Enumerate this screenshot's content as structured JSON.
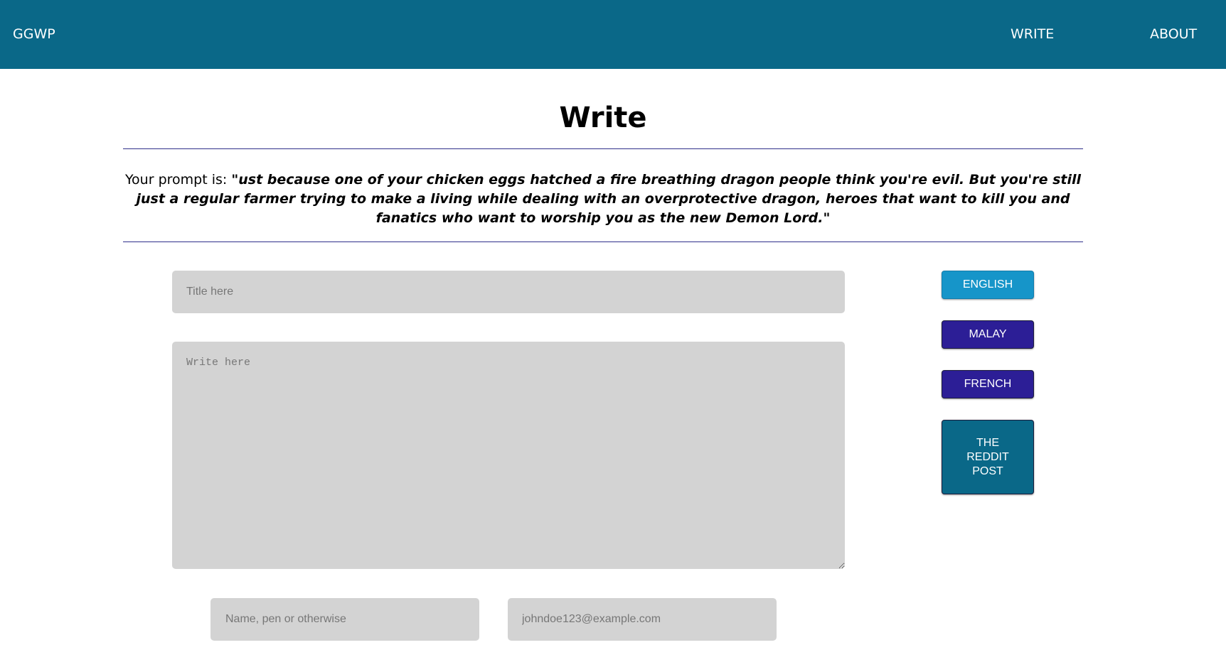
{
  "nav": {
    "brand": "GGWP",
    "links": [
      "WRITE",
      "ABOUT"
    ]
  },
  "page": {
    "title": "Write"
  },
  "prompt": {
    "label": "Your prompt is: ",
    "text": "\"ust because one of your chicken eggs hatched a fire breathing dragon people think you're evil. But you're still just a regular farmer trying to make a living while dealing with an overprotective dragon, heroes that want to kill you and fanatics who want to worship you as the new Demon Lord.\""
  },
  "form": {
    "title_placeholder": "Title here",
    "body_placeholder": "Write here",
    "name_placeholder": "Name, pen or otherwise",
    "email_placeholder": "johndoe123@example.com"
  },
  "buttons": {
    "english": "ENGLISH",
    "malay": "MALAY",
    "french": "FRENCH",
    "reddit": "THE REDDIT POST"
  },
  "colors": {
    "navbar": "#0a6888",
    "english_button": "#1695c9",
    "language_button": "#2c1e96",
    "reddit_button": "#0a6888",
    "field_background": "#d3d3d3",
    "divider": "#2f2f8a"
  }
}
